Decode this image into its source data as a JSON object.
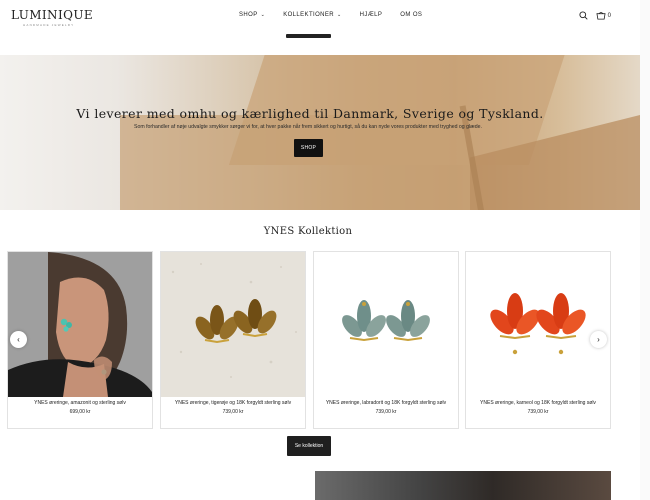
{
  "header": {
    "logo": "LUMINIQUE",
    "logo_sub": "HANDMADE JEWELRY",
    "nav": [
      {
        "label": "SHOP",
        "has_dropdown": true
      },
      {
        "label": "KOLLEKTIONER",
        "has_dropdown": true
      },
      {
        "label": "HJÆLP",
        "has_dropdown": false
      },
      {
        "label": "OM OS",
        "has_dropdown": false
      }
    ],
    "cart_count": "0",
    "icons": [
      "search-icon",
      "cart-icon"
    ]
  },
  "hero": {
    "title": "Vi leverer med omhu og kærlighed til Danmark, Sverige og Tyskland.",
    "subtitle": "Som forhandler af nøje udvalgte smykker sørger vi for, at hver pakke når frem sikkert og hurtigt, så du kan nyde vores produkter med tryghed og glæde.",
    "button": "SHOP"
  },
  "collection": {
    "title": "YNES Kollektion",
    "products": [
      {
        "name": "YNES øreringe, amazonit og sterling sølv",
        "price": "699,00 kr"
      },
      {
        "name": "YNES øreringe, tigerøje og 18K forgyldt sterling sølv",
        "price": "739,00 kr"
      },
      {
        "name": "YNES øreringe, labradorit og 18K forgyldt sterling sølv",
        "price": "739,00 kr"
      },
      {
        "name": "YNES øreringe, karneol og 18K forgyldt sterling sølv",
        "price": "739,00 kr"
      }
    ],
    "prev_arrow": "‹",
    "next_arrow": "›",
    "button": "Se kollektion"
  },
  "colors": {
    "accent": "#111111",
    "amazonite": "#3fb8a6",
    "tigereye": "#8a6420",
    "labradorite": "#6f8f8a",
    "carnelian": "#e2461c",
    "gold": "#c9a13b"
  }
}
